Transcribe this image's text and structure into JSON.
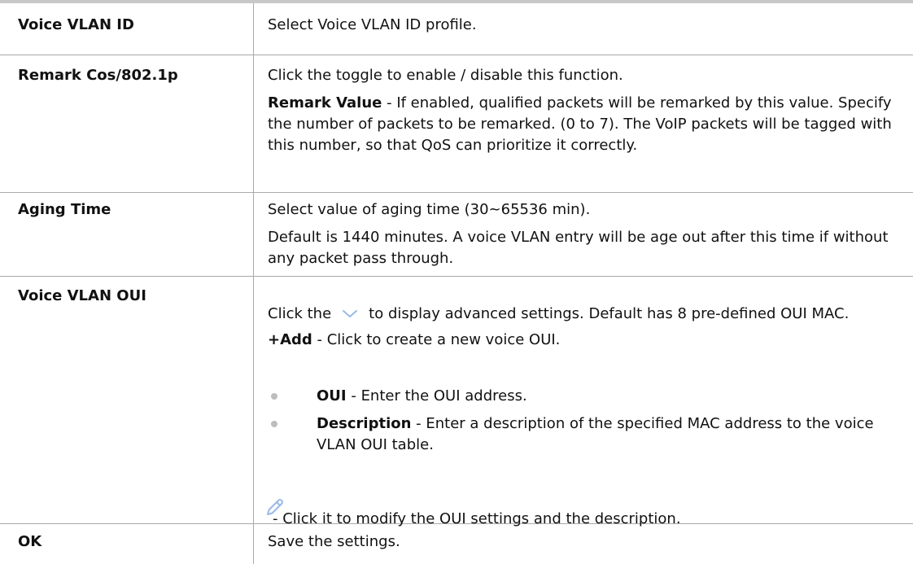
{
  "rows": [
    {
      "term": "Voice VLAN ID",
      "desc": "Select Voice VLAN ID profile."
    },
    {
      "term": "Remark Cos/802.1p",
      "desc1": "Click the toggle to enable / disable this function.",
      "desc2_bold": "Remark Value",
      "desc2_rest": " - If enabled, qualified packets will be remarked by this value. Specify the number of packets to be remarked. (0 to 7). The VoIP packets will be tagged with this number, so that QoS can prioritize it correctly."
    },
    {
      "term": "Aging Time",
      "desc1": "Select value of aging time (30~65536 min).",
      "desc2": "Default is 1440 minutes. A voice VLAN entry will be age out after this time if without any packet pass through."
    },
    {
      "term": "Voice VLAN OUI",
      "desc1_pre": "Click the",
      "desc1_post": "to display advanced settings. Default has 8 pre-defined OUI MAC.",
      "add_bold": "+Add",
      "add_rest": " - Click to create a new voice OUI.",
      "bullets": [
        {
          "bold": "OUI",
          "rest": " - Enter the OUI address."
        },
        {
          "bold": "Description",
          "rest": " - Enter a description of the specified MAC address to the voice VLAN OUI table."
        }
      ],
      "edit_text": "- Click it to modify the OUI settings and the description."
    },
    {
      "term": "OK",
      "desc": "Save the settings."
    }
  ],
  "icons": {
    "chevron": "chevron-down-icon",
    "edit": "pencil-icon"
  },
  "colors": {
    "rule": "#a9a9a9",
    "top_rule": "#c8c8c8",
    "icon": "#9ab8e8",
    "bullet": "#bdbdbd"
  }
}
